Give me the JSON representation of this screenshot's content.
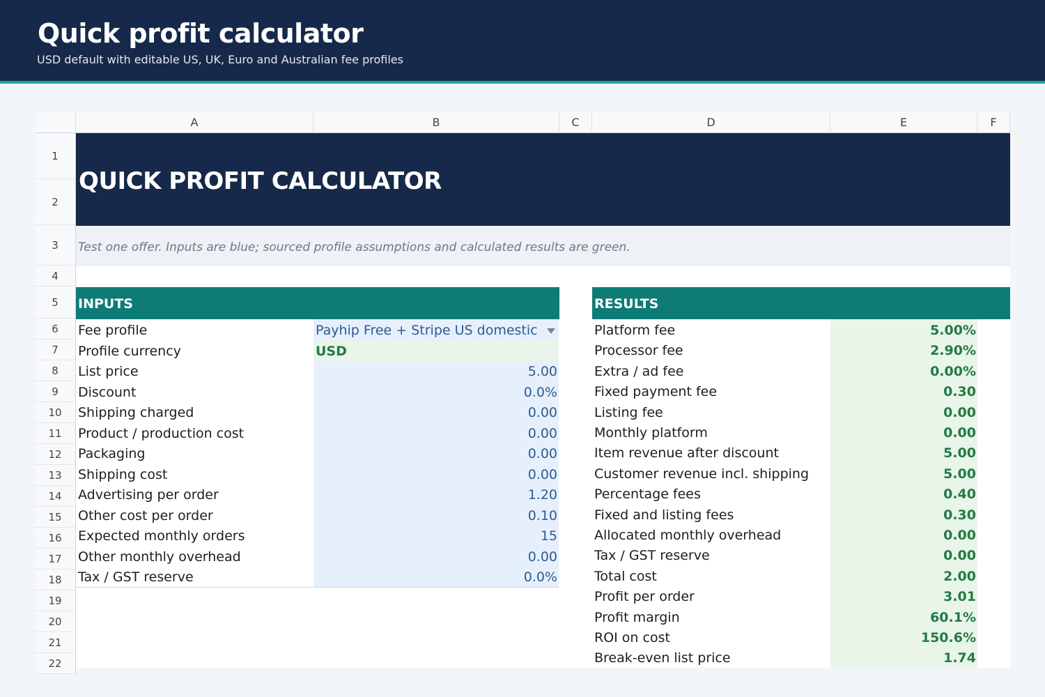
{
  "app": {
    "title": "Quick profit calculator",
    "subtitle": "USD default with editable US, UK, Euro and Australian fee profiles"
  },
  "columns": [
    "A",
    "B",
    "C",
    "D",
    "E",
    "F"
  ],
  "rows": [
    "1",
    "2",
    "3",
    "4",
    "5",
    "6",
    "7",
    "8",
    "9",
    "10",
    "11",
    "12",
    "13",
    "14",
    "15",
    "16",
    "17",
    "18",
    "19",
    "20",
    "21",
    "22"
  ],
  "sheet": {
    "banner": "QUICK PROFIT CALCULATOR",
    "note": "Test one offer. Inputs are blue; sourced profile assumptions and calculated results are green."
  },
  "inputs": {
    "header": "INPUTS",
    "fee_profile": {
      "label": "Fee profile",
      "value": "Payhip Free + Stripe US domestic"
    },
    "profile_currency": {
      "label": "Profile currency",
      "value": "USD"
    },
    "items": [
      {
        "label": "List price",
        "value": "5.00"
      },
      {
        "label": "Discount",
        "value": "0.0%"
      },
      {
        "label": "Shipping charged",
        "value": "0.00"
      },
      {
        "label": "Product / production cost",
        "value": "0.00"
      },
      {
        "label": "Packaging",
        "value": "0.00"
      },
      {
        "label": "Shipping cost",
        "value": "0.00"
      },
      {
        "label": "Advertising per order",
        "value": "1.20"
      },
      {
        "label": "Other cost per order",
        "value": "0.10"
      },
      {
        "label": "Expected monthly orders",
        "value": "15"
      },
      {
        "label": "Other monthly overhead",
        "value": "0.00"
      },
      {
        "label": "Tax / GST reserve",
        "value": "0.0%"
      }
    ]
  },
  "results": {
    "header": "RESULTS",
    "items": [
      {
        "label": "Platform fee",
        "value": "5.00%"
      },
      {
        "label": "Processor fee",
        "value": "2.90%"
      },
      {
        "label": "Extra / ad fee",
        "value": "0.00%"
      },
      {
        "label": "Fixed payment fee",
        "value": "0.30"
      },
      {
        "label": "Listing fee",
        "value": "0.00"
      },
      {
        "label": "Monthly platform",
        "value": "0.00"
      },
      {
        "label": "Item revenue after discount",
        "value": "5.00"
      },
      {
        "label": "Customer revenue incl. shipping",
        "value": "5.00"
      },
      {
        "label": "Percentage fees",
        "value": "0.40"
      },
      {
        "label": "Fixed and listing fees",
        "value": "0.30"
      },
      {
        "label": "Allocated monthly overhead",
        "value": "0.00"
      },
      {
        "label": "Tax / GST reserve",
        "value": "0.00"
      },
      {
        "label": "Total cost",
        "value": "2.00"
      },
      {
        "label": "Profit per order",
        "value": "3.01"
      },
      {
        "label": "Profit margin",
        "value": "60.1%"
      },
      {
        "label": "ROI on cost",
        "value": "150.6%"
      },
      {
        "label": "Break-even list price",
        "value": "1.74"
      }
    ]
  },
  "colors": {
    "header_bg": "#16294a",
    "section_bg": "#0e7b76",
    "input_fill": "#e6f0fc",
    "result_fill": "#e8f5e8",
    "input_text": "#2e5b8f",
    "result_text": "#237a45"
  }
}
